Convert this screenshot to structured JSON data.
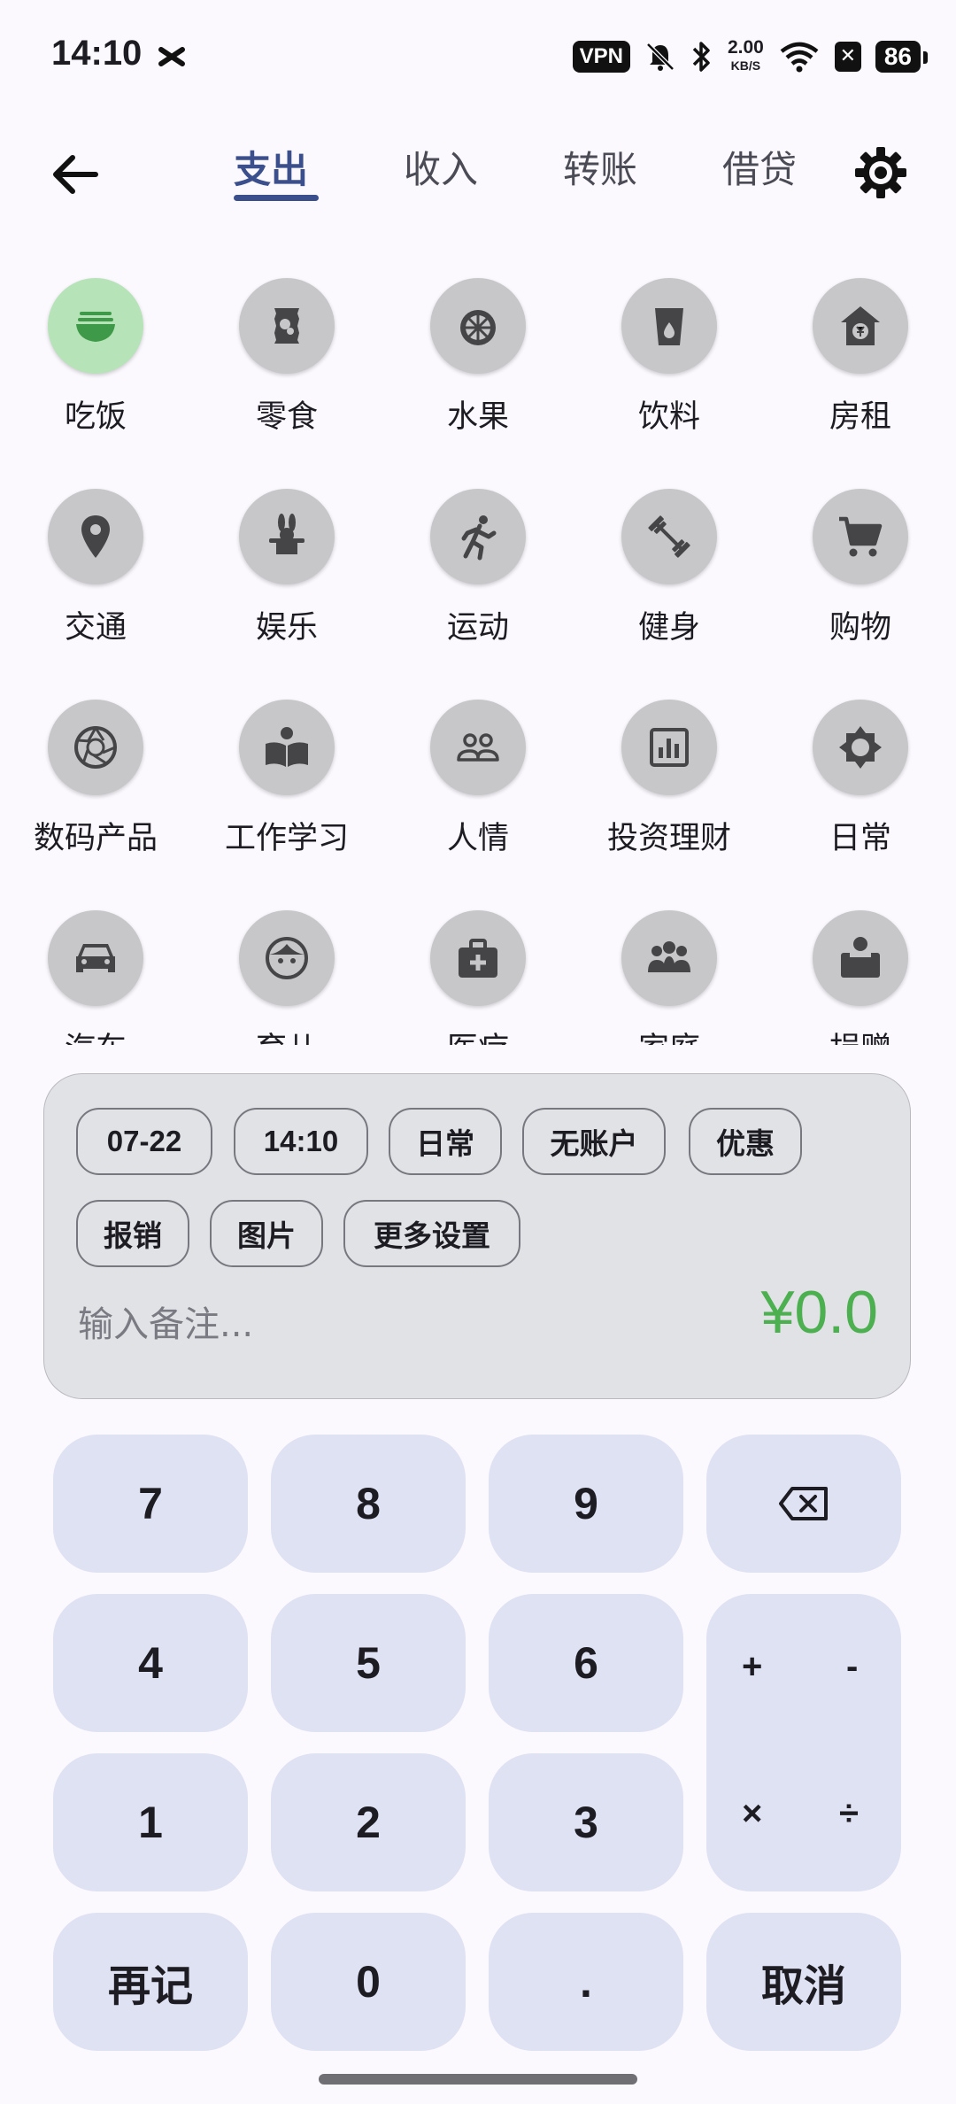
{
  "status_bar": {
    "time": "14:10",
    "vpn": "VPN",
    "speed_value": "2.00",
    "speed_unit": "KB/S",
    "battery": "86"
  },
  "tabs": [
    {
      "label": "支出",
      "active": true
    },
    {
      "label": "收入",
      "active": false
    },
    {
      "label": "转账",
      "active": false
    },
    {
      "label": "借贷",
      "active": false
    }
  ],
  "categories": [
    {
      "label": "吃饭",
      "icon": "rice-bowl-icon",
      "selected": true
    },
    {
      "label": "零食",
      "icon": "snack-bag-icon"
    },
    {
      "label": "水果",
      "icon": "fruit-slice-icon"
    },
    {
      "label": "饮料",
      "icon": "drink-cup-icon"
    },
    {
      "label": "房租",
      "icon": "house-yen-icon"
    },
    {
      "label": "交通",
      "icon": "location-pin-icon"
    },
    {
      "label": "娱乐",
      "icon": "magic-hat-icon"
    },
    {
      "label": "运动",
      "icon": "running-icon"
    },
    {
      "label": "健身",
      "icon": "dumbbell-icon"
    },
    {
      "label": "购物",
      "icon": "shopping-cart-icon"
    },
    {
      "label": "数码产品",
      "icon": "camera-shutter-icon"
    },
    {
      "label": "工作学习",
      "icon": "book-reader-icon"
    },
    {
      "label": "人情",
      "icon": "people-icon"
    },
    {
      "label": "投资理财",
      "icon": "bar-chart-icon"
    },
    {
      "label": "日常",
      "icon": "sun-icon"
    },
    {
      "label": "汽车",
      "icon": "car-icon"
    },
    {
      "label": "育儿",
      "icon": "child-face-icon"
    },
    {
      "label": "医疗",
      "icon": "medical-kit-icon"
    },
    {
      "label": "家庭",
      "icon": "family-icon"
    },
    {
      "label": "捐赠",
      "icon": "donation-box-icon"
    }
  ],
  "chips": [
    "07-22",
    "14:10",
    "日常",
    "无账户",
    "优惠",
    "报销",
    "图片",
    "更多设置"
  ],
  "note_placeholder": "输入备注...",
  "amount": "¥0.0",
  "keypad": {
    "k7": "7",
    "k8": "8",
    "k9": "9",
    "k4": "4",
    "k5": "5",
    "k6": "6",
    "k1": "1",
    "k2": "2",
    "k3": "3",
    "k0": "0",
    "dot": ".",
    "again": "再记",
    "cancel": "取消",
    "plus": "+",
    "minus": "-",
    "times": "×",
    "divide": "÷"
  },
  "colors": {
    "accent": "#3b4f8c",
    "amount": "#4caf50",
    "selected_category": "#b6e3b8",
    "category_circle": "#c7c7c9",
    "key_background": "#dfe2f3"
  }
}
